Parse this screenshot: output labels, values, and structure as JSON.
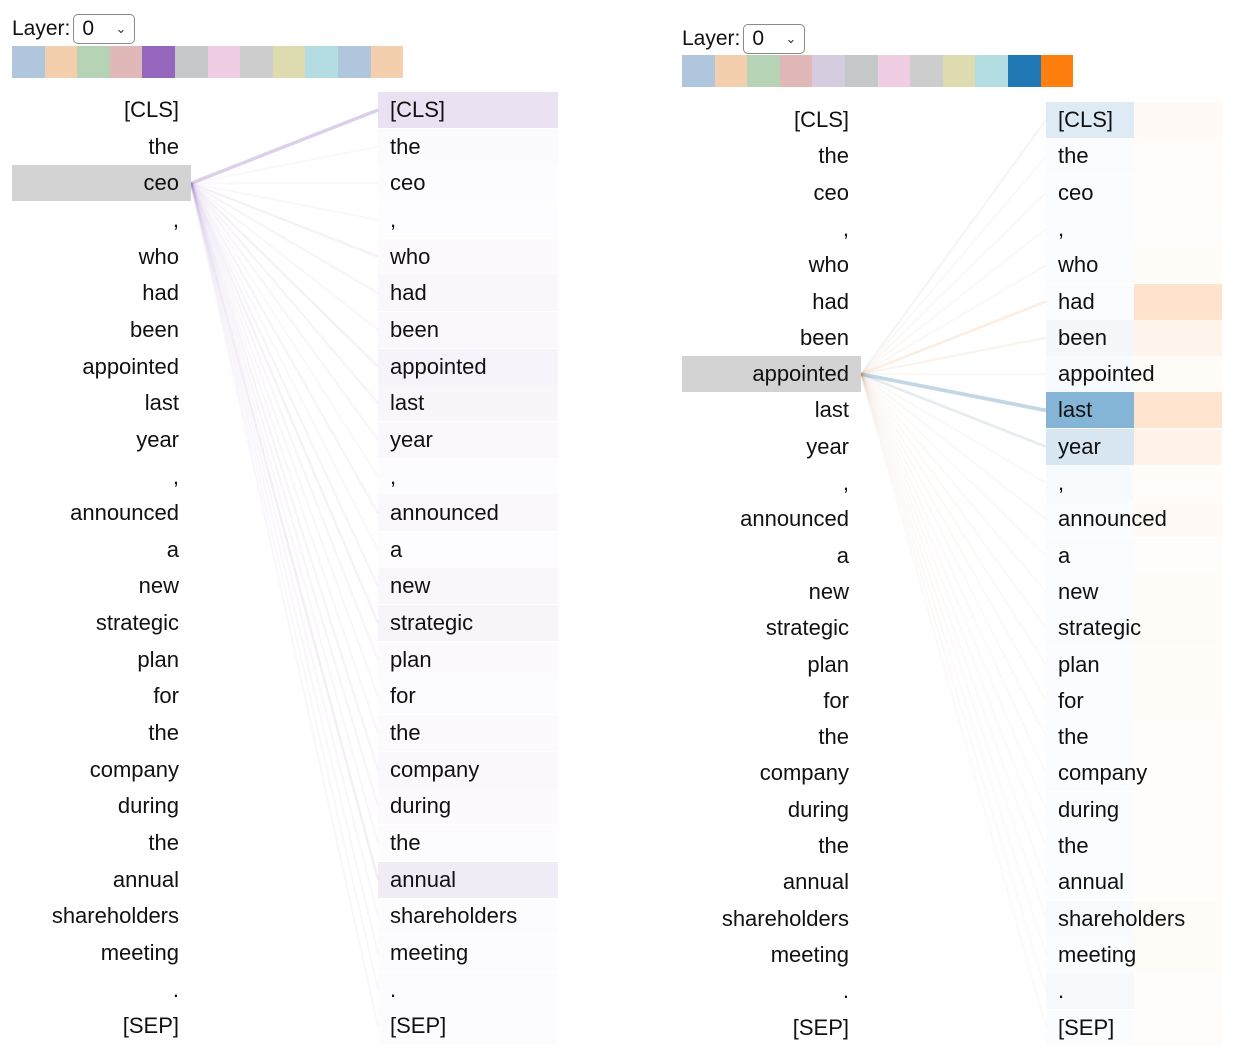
{
  "tokens": [
    "[CLS]",
    "the",
    "ceo",
    ",",
    "who",
    "had",
    "been",
    "appointed",
    "last",
    "year",
    ",",
    "announced",
    "a",
    "new",
    "strategic",
    "plan",
    "for",
    "the",
    "company",
    "during",
    "the",
    "annual",
    "shareholders",
    "meeting",
    ".",
    "[SEP]"
  ],
  "panels": [
    {
      "id": "left",
      "layer_label": "Layer:",
      "layer_value": "0",
      "head_colors": [
        "#afc6dc",
        "#f3cfae",
        "#b6d3b6",
        "#e1b8b8",
        "#9467bd",
        "#c4c8c8",
        "#efcde2",
        "#cdcdcd",
        "#dedbb0",
        "#b3dde3",
        "#afc6dc",
        "#f3cfae"
      ],
      "selected_head_color": "#9467bd",
      "selected_token_index": 2,
      "right_bar_weights": [
        0.32,
        0.06,
        0.04,
        0.03,
        0.05,
        0.09,
        0.07,
        0.13,
        0.1,
        0.08,
        0.04,
        0.07,
        0.03,
        0.09,
        0.12,
        0.05,
        0.04,
        0.05,
        0.07,
        0.05,
        0.04,
        0.22,
        0.04,
        0.04,
        0.04,
        0.04
      ],
      "attention_weights": [
        0.35,
        0.05,
        0.05,
        0.05,
        0.1,
        0.08,
        0.06,
        0.1,
        0.08,
        0.07,
        0.05,
        0.08,
        0.05,
        0.08,
        0.09,
        0.07,
        0.06,
        0.06,
        0.08,
        0.07,
        0.06,
        0.12,
        0.06,
        0.06,
        0.05,
        0.06
      ]
    },
    {
      "id": "right",
      "layer_label": "Layer:",
      "layer_value": "0",
      "head_colors": [
        "#afc6dc",
        "#f3cfae",
        "#b6d3b6",
        "#e1b8b8",
        "#d5cce0",
        "#c4c8c8",
        "#efcde2",
        "#cdcdcd",
        "#dedbb0",
        "#b3dde3",
        "#1f77b4",
        "#ff7f0e"
      ],
      "selected_heads": [
        {
          "color": "#1f77b4",
          "bar_weights": [
            0.15,
            0.02,
            0.02,
            0.02,
            0.02,
            0.02,
            0.05,
            0.03,
            0.55,
            0.18,
            0.03,
            0.02,
            0.02,
            0.02,
            0.02,
            0.02,
            0.02,
            0.02,
            0.02,
            0.02,
            0.02,
            0.02,
            0.03,
            0.02,
            0.04,
            0.02
          ],
          "attention_weights": [
            0.08,
            0.03,
            0.03,
            0.03,
            0.03,
            0.03,
            0.04,
            0.03,
            0.45,
            0.18,
            0.03,
            0.03,
            0.02,
            0.02,
            0.02,
            0.02,
            0.02,
            0.02,
            0.02,
            0.02,
            0.02,
            0.02,
            0.02,
            0.02,
            0.02,
            0.02
          ]
        },
        {
          "color": "#ff7f0e",
          "bar_weights": [
            0.04,
            0.02,
            0.02,
            0.01,
            0.03,
            0.22,
            0.08,
            0.03,
            0.2,
            0.09,
            0.02,
            0.04,
            0.01,
            0.03,
            0.03,
            0.03,
            0.03,
            0.02,
            0.02,
            0.02,
            0.02,
            0.02,
            0.03,
            0.03,
            0.01,
            0.02
          ],
          "attention_weights": [
            0.04,
            0.04,
            0.05,
            0.04,
            0.06,
            0.18,
            0.1,
            0.05,
            0.06,
            0.06,
            0.04,
            0.05,
            0.04,
            0.05,
            0.05,
            0.05,
            0.05,
            0.04,
            0.04,
            0.04,
            0.04,
            0.04,
            0.04,
            0.04,
            0.03,
            0.04
          ]
        }
      ],
      "selected_token_index": 7
    }
  ]
}
